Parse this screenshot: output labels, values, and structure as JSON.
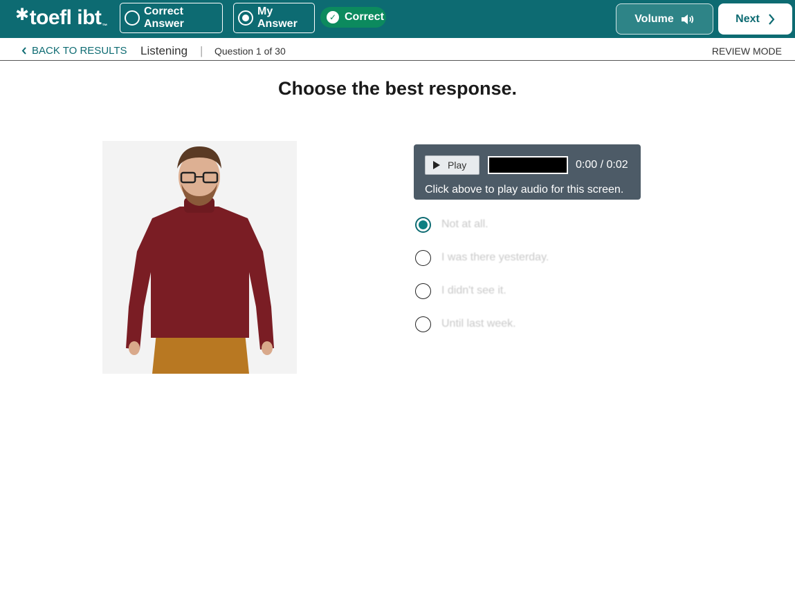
{
  "header": {
    "logo_text": "toefl ibt",
    "correct_answer_label": "Correct Answer",
    "my_answer_label": "My Answer",
    "status_badge": "Correct",
    "volume_label": "Volume",
    "next_label": "Next",
    "colors": {
      "bar": "#0d6b72",
      "badge": "#0c8a5e"
    }
  },
  "subheader": {
    "back_label": "BACK TO RESULTS",
    "section": "Listening",
    "separator": "|",
    "question_counter": "Question 1 of 30",
    "mode": "REVIEW MODE"
  },
  "main": {
    "instruction": "Choose the best response.",
    "audio": {
      "play_label": "Play",
      "time": "0:00 / 0:02",
      "hint": "Click above to play audio for this screen."
    },
    "options": [
      {
        "text": "Not at all.",
        "selected": true
      },
      {
        "text": "I was there yesterday.",
        "selected": false
      },
      {
        "text": "I didn't see it.",
        "selected": false
      },
      {
        "text": "Until last week.",
        "selected": false
      }
    ]
  }
}
